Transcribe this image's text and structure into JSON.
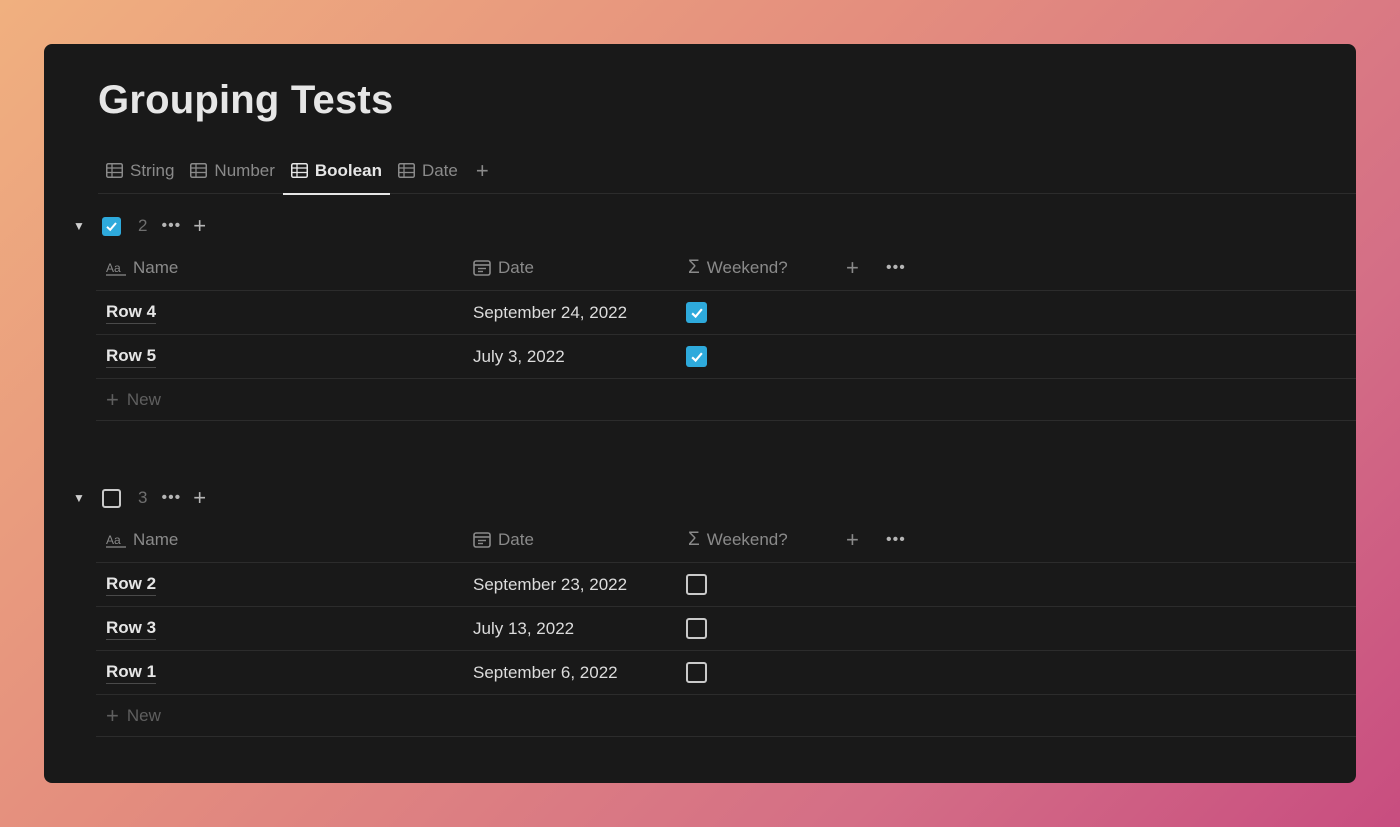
{
  "page": {
    "title": "Grouping Tests"
  },
  "tabs": [
    {
      "label": "String",
      "active": false
    },
    {
      "label": "Number",
      "active": false
    },
    {
      "label": "Boolean",
      "active": true
    },
    {
      "label": "Date",
      "active": false
    }
  ],
  "tab_add_label": "+",
  "columns": {
    "name": "Name",
    "date": "Date",
    "weekend": "Weekend?"
  },
  "groups": [
    {
      "checked": true,
      "count": "2",
      "rows": [
        {
          "name": "Row 4",
          "date": "September 24, 2022",
          "weekend": true
        },
        {
          "name": "Row 5",
          "date": "July 3, 2022",
          "weekend": true
        }
      ],
      "new_label": "New"
    },
    {
      "checked": false,
      "count": "3",
      "rows": [
        {
          "name": "Row 2",
          "date": "September 23, 2022",
          "weekend": false
        },
        {
          "name": "Row 3",
          "date": "July 13, 2022",
          "weekend": false
        },
        {
          "name": "Row 1",
          "date": "September 6, 2022",
          "weekend": false
        }
      ],
      "new_label": "New"
    }
  ],
  "colors": {
    "accent": "#2eaadc",
    "background": "#191919",
    "text": "#e6e6e6",
    "muted": "#8a8a8a"
  },
  "icons": {
    "tab": "table-icon",
    "name_col": "text-aa-icon",
    "date_col": "calendar-icon",
    "weekend_col": "sigma-formula-icon"
  }
}
